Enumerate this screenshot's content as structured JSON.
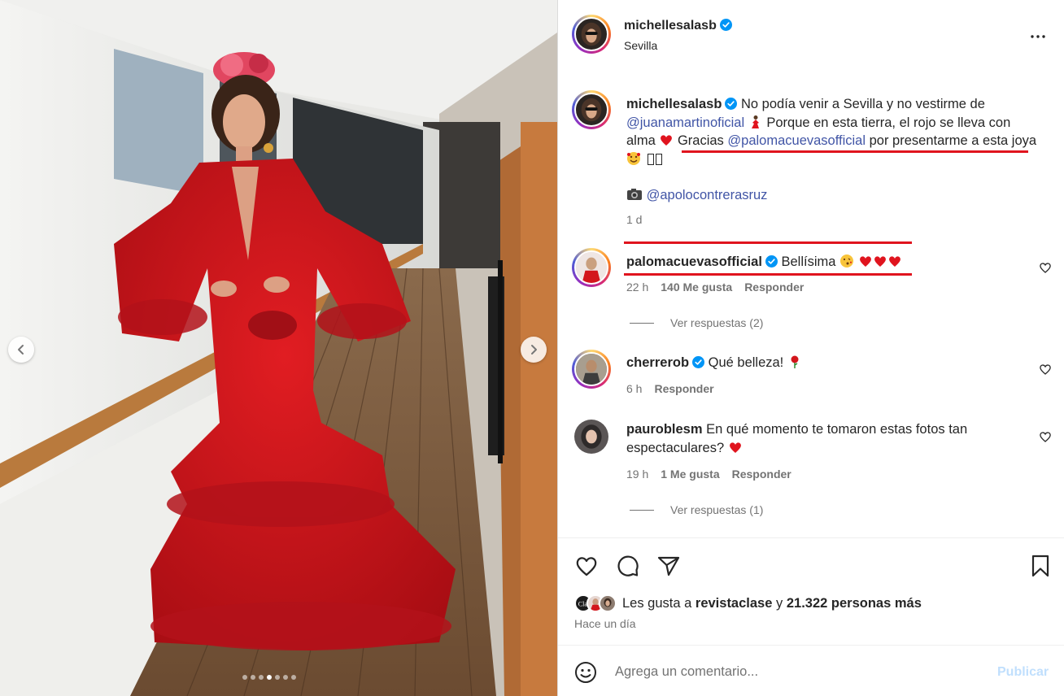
{
  "post": {
    "carousel_dots": 7,
    "active_dot": 3,
    "author": {
      "username": "michellesalasb",
      "location": "Sevilla",
      "verified": true
    },
    "caption": {
      "text1": "No podía venir a Sevilla y no vestirme de",
      "mention1": "@juanamartinoficial",
      "text2": "Porque en esta tierra, el rojo se lleva con alma",
      "text3": "Gracias",
      "mention2": "@palomacuevasofficial",
      "text4": "por presentarme a esta joya",
      "credit_mention": "@apolocontrerasruz",
      "time": "1 d"
    },
    "comments": [
      {
        "username": "palomacuevasofficial",
        "verified": true,
        "text": "Bellísima",
        "time": "22 h",
        "likes": "140 Me gusta",
        "reply": "Responder",
        "view_replies": "Ver respuestas (2)"
      },
      {
        "username": "cherrerob",
        "verified": true,
        "text": "Qué belleza!",
        "time": "6 h",
        "reply": "Responder"
      },
      {
        "username": "paurobles m",
        "username_display": "pauroblesm",
        "verified": false,
        "text": "En qué momento te tomaron estas fotos tan espectaculares?",
        "time": "19 h",
        "likes": "1 Me gusta",
        "reply": "Responder",
        "view_replies": "Ver respuestas (1)"
      }
    ],
    "likes": {
      "prefix": "Les gusta a",
      "user": "revistaclase",
      "connector": "y",
      "others": "21.322 personas más"
    },
    "time_ago": "Hace un día",
    "comment_box": {
      "placeholder": "Agrega un comentario...",
      "publish_label": "Publicar"
    },
    "colors": {
      "mention": "#4155a6",
      "annotation_red": "#e0141e",
      "verified_blue": "#0095f6",
      "dress_red": "#d3161c"
    }
  }
}
